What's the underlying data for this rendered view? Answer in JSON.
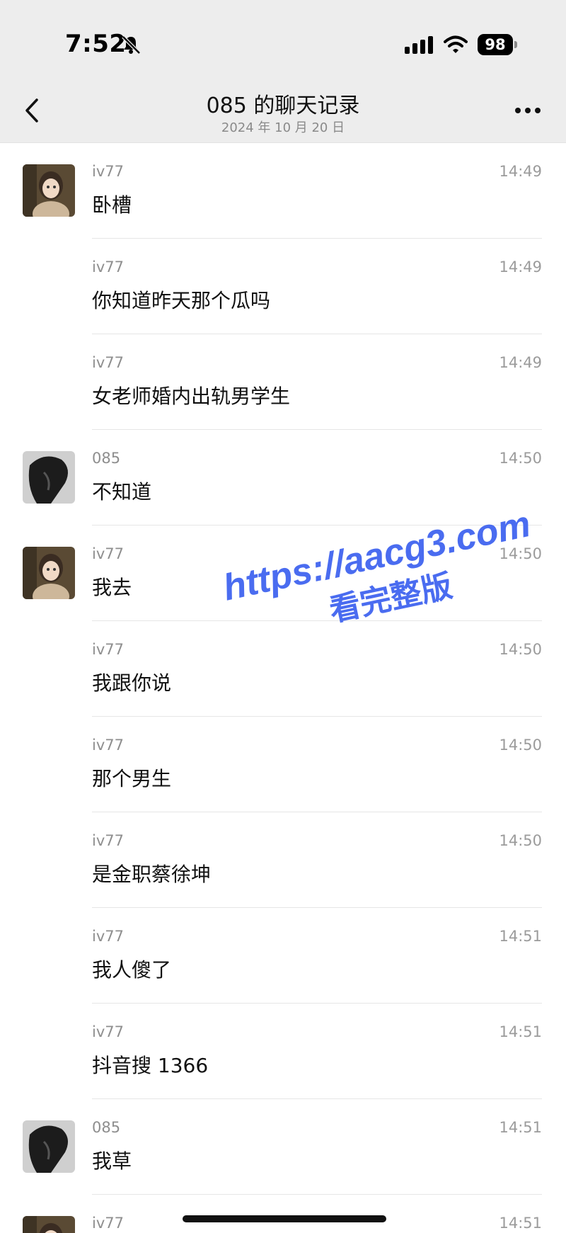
{
  "status": {
    "time": "7:52",
    "battery": "98",
    "bell_icon": "bell-slash-icon",
    "signal_icon": "cellular-signal-icon",
    "wifi_icon": "wifi-icon"
  },
  "nav": {
    "title": "085 的聊天记录",
    "subtitle": "2024 年 10 月 20 日",
    "back_icon": "chevron-left-icon",
    "more_icon": "ellipsis-icon"
  },
  "messages": [
    {
      "sender": "iv77",
      "time": "14:49",
      "text": "卧槽",
      "avatar": "iv77"
    },
    {
      "sender": "iv77",
      "time": "14:49",
      "text": "你知道昨天那个瓜吗",
      "avatar": ""
    },
    {
      "sender": "iv77",
      "time": "14:49",
      "text": "女老师婚内出轨男学生",
      "avatar": ""
    },
    {
      "sender": "085",
      "time": "14:50",
      "text": "不知道",
      "avatar": "085"
    },
    {
      "sender": "iv77",
      "time": "14:50",
      "text": "我去",
      "avatar": "iv77"
    },
    {
      "sender": "iv77",
      "time": "14:50",
      "text": "我跟你说",
      "avatar": ""
    },
    {
      "sender": "iv77",
      "time": "14:50",
      "text": "那个男生",
      "avatar": ""
    },
    {
      "sender": "iv77",
      "time": "14:50",
      "text": "是金职蔡徐坤",
      "avatar": ""
    },
    {
      "sender": "iv77",
      "time": "14:51",
      "text": "我人傻了",
      "avatar": ""
    },
    {
      "sender": "iv77",
      "time": "14:51",
      "text": "抖音搜 1366",
      "avatar": ""
    },
    {
      "sender": "085",
      "time": "14:51",
      "text": "我草",
      "avatar": "085"
    },
    {
      "sender": "iv77",
      "time": "14:51",
      "text": "",
      "avatar": "iv77"
    }
  ],
  "watermark": {
    "line1": "https://aacg3.com",
    "line2": "看完整版",
    "color": "#4a6cf0"
  },
  "colors": {
    "nav_background": "#ededed",
    "divider": "#e6e6e6",
    "meta_text": "#8e8e8e"
  }
}
